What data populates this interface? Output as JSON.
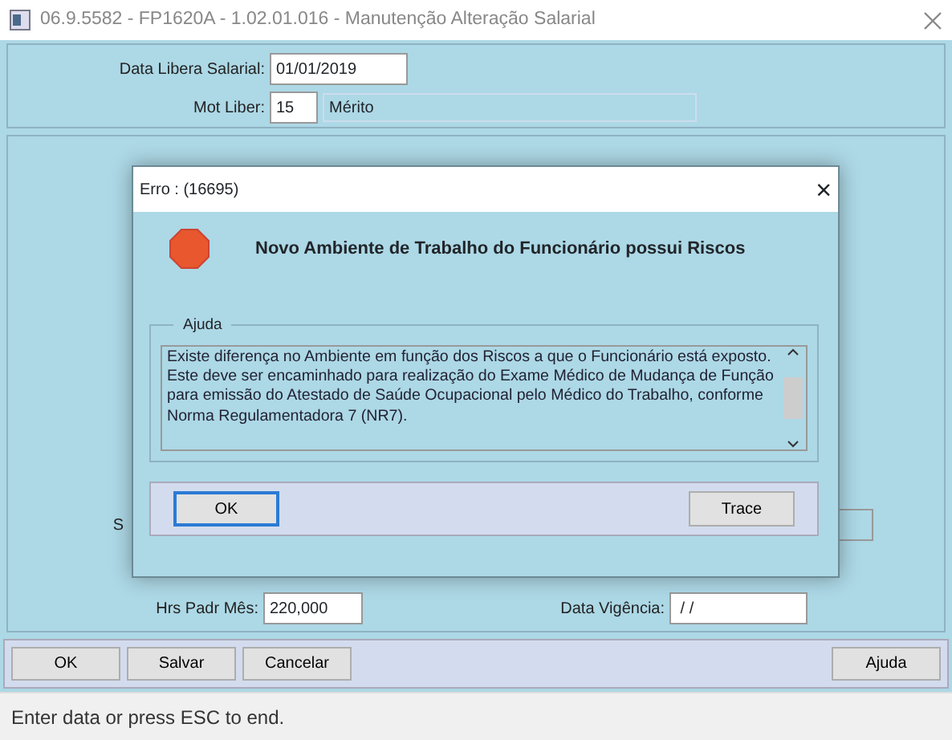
{
  "window": {
    "title": "06.9.5582 - FP1620A - 1.02.01.016 - Manutenção Alteração Salarial"
  },
  "header_fields": [
    {
      "label": "Data Libera Salarial:",
      "value": "01/01/2019"
    },
    {
      "label": "Mot Liber:",
      "value": "15",
      "description": "Mérito"
    }
  ],
  "hidden_rows": [
    {
      "label": "S"
    }
  ],
  "bottom_fields": [
    {
      "label": "Hrs Padr Mês:",
      "value": "220,000"
    },
    {
      "label": "Data Vigência:",
      "value": " / /"
    }
  ],
  "buttons_left": [
    "OK",
    "Salvar",
    "Cancelar"
  ],
  "buttons_right": [
    "Ajuda"
  ],
  "status_bar": "Enter data or press ESC to end.",
  "dialog": {
    "title": "Erro : (16695)",
    "close": "×",
    "message": "Novo Ambiente de Trabalho do Funcionário possui Riscos",
    "group_label": "Ajuda",
    "help_text": "Existe diferença no Ambiente em função dos Riscos a que o Funcionário  está exposto. Este deve ser encaminhado para realização do Exame Médico de Mudança de Função para emissão do Atestado de Saúde Ocupacional pelo Médico do Trabalho, conforme Norma Regulamentadora 7 (NR7).",
    "buttons": [
      {
        "label": "OK",
        "focused": true
      },
      {
        "label": "Trace",
        "focused": false
      }
    ]
  }
}
